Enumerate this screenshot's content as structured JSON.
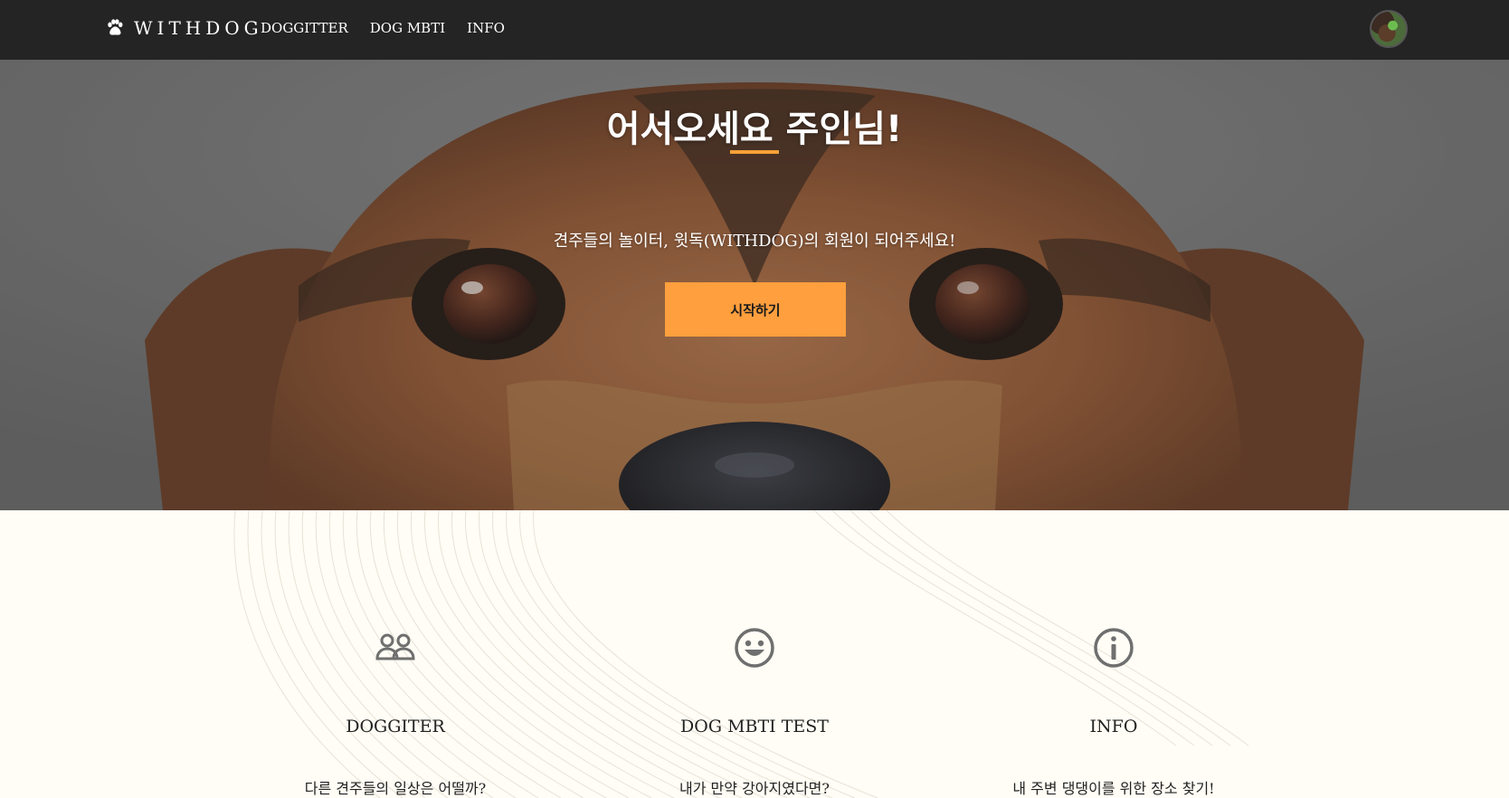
{
  "navbar": {
    "brand": "WITHDOG",
    "brand_icon": "paw-icon",
    "links": [
      "DOGGITTER",
      "DOG MBTI",
      "INFO"
    ]
  },
  "hero": {
    "title": "어서오세요 주인님!",
    "subtitle": "견주들의 놀이터, 윗독(WITHDOG)의 회원이 되어주세요!",
    "button_label": "시작하기",
    "accent_color": "#ff9f3d"
  },
  "features": [
    {
      "icon": "users-icon",
      "title": "DOGGITER",
      "description": "다른 견주들의 일상은 어떨까?"
    },
    {
      "icon": "smile-icon",
      "title": "DOG MBTI TEST",
      "description": "내가 만약 강아지였다면?"
    },
    {
      "icon": "info-icon",
      "title": "INFO",
      "description": "내 주변 댕댕이를 위한 장소 찾기!"
    }
  ],
  "colors": {
    "navbar_bg": "#242424",
    "accent": "#f7a138",
    "section_bg": "#fffdf5"
  }
}
